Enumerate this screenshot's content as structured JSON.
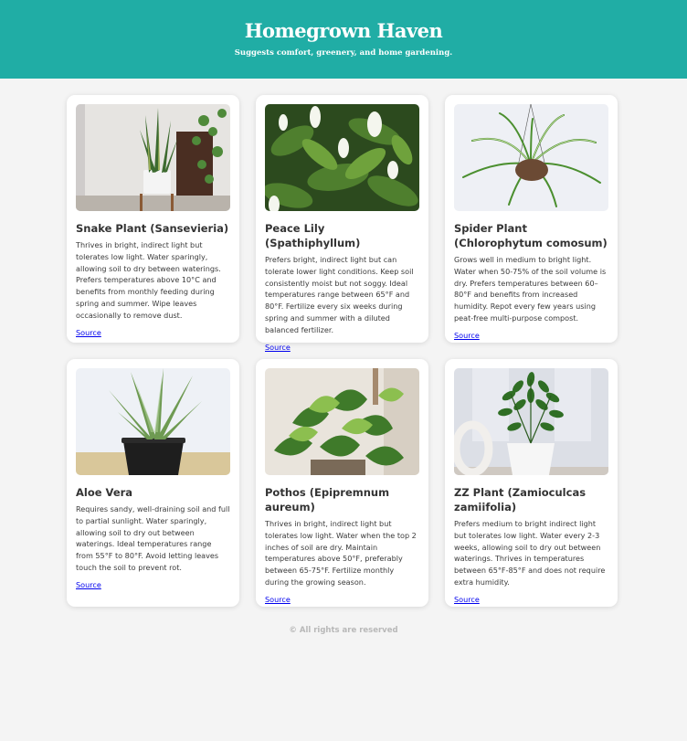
{
  "header": {
    "title": "Homegrown Haven",
    "tagline": "Suggests comfort, greenery, and home gardening."
  },
  "cards": [
    {
      "title": "Snake Plant (Sansevieria)",
      "description": "Thrives in bright, indirect light but tolerates low light. Water sparingly, allowing soil to dry between waterings. Prefers temperatures above 10°C and benefits from monthly feeding during spring and summer. Wipe leaves occasionally to remove dust.",
      "link": "Source"
    },
    {
      "title": "Peace Lily (Spathiphyllum)",
      "description": "Prefers bright, indirect light but can tolerate lower light conditions. Keep soil consistently moist but not soggy. Ideal temperatures range between 65°F and 80°F. Fertilize every six weeks during spring and summer with a diluted balanced fertilizer.",
      "link": "Source"
    },
    {
      "title": "Spider Plant (Chlorophytum comosum)",
      "description": "Grows well in medium to bright light. Water when 50-75% of the soil volume is dry. Prefers temperatures between 60–80°F and benefits from increased humidity. Repot every few years using peat-free multi-purpose compost.",
      "link": "Source"
    },
    {
      "title": "Aloe Vera",
      "description": "Requires sandy, well-draining soil and full to partial sunlight. Water sparingly, allowing soil to dry out between waterings. Ideal temperatures range from 55°F to 80°F. Avoid letting leaves touch the soil to prevent rot.",
      "link": "Source"
    },
    {
      "title": "Pothos (Epipremnum aureum)",
      "description": "Thrives in bright, indirect light but tolerates low light. Water when the top 2 inches of soil are dry. Maintain temperatures above 50°F, preferably between 65-75°F. Fertilize monthly during the growing season.",
      "link": "Source"
    },
    {
      "title": "ZZ Plant (Zamioculcas zamiifolia)",
      "description": "Prefers medium to bright indirect light but tolerates low light. Water every 2-3 weeks, allowing soil to dry out between waterings. Thrives in temperatures between 65°F-85°F and does not require extra humidity.",
      "link": "Source"
    }
  ],
  "footer": {
    "text": "© All rights are reserved"
  },
  "colors": {
    "header_bg": "#20ada5",
    "page_bg": "#f4f4f4",
    "link": "#0000ee"
  }
}
